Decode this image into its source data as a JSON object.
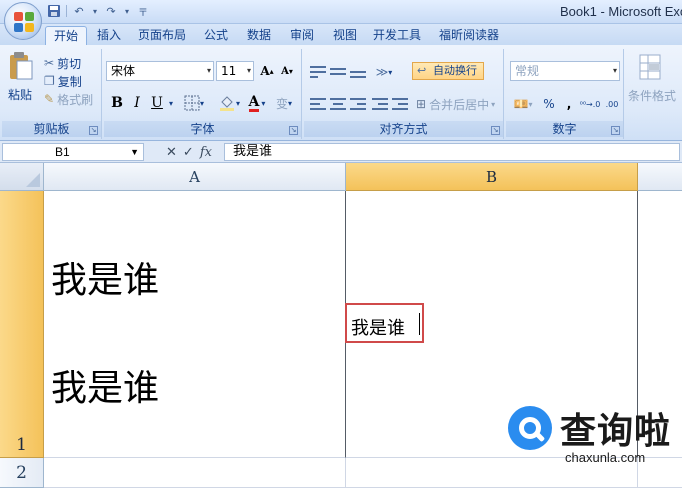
{
  "app": {
    "window_title": "Book1 - Microsoft Exc"
  },
  "tabs": [
    {
      "label": "开始",
      "active": true
    },
    {
      "label": "插入"
    },
    {
      "label": "页面布局"
    },
    {
      "label": "公式"
    },
    {
      "label": "数据"
    },
    {
      "label": "审阅"
    },
    {
      "label": "视图"
    },
    {
      "label": "开发工具"
    },
    {
      "label": "福昕阅读器"
    }
  ],
  "ribbon": {
    "clipboard": {
      "paste_label": "粘贴",
      "cut_label": "剪切",
      "copy_label": "复制",
      "format_painter_label": "格式刷",
      "group_label": "剪贴板"
    },
    "font": {
      "font_name": "宋体",
      "font_size": "11",
      "bold": "B",
      "italic": "I",
      "underline": "U",
      "grow_glyph": "A",
      "shrink_glyph": "A",
      "font_color_glyph": "A",
      "phonetic_glyph": "变",
      "group_label": "字体"
    },
    "alignment": {
      "wrap_text_label": "自动换行",
      "merge_center_label": "合并后居中",
      "group_label": "对齐方式"
    },
    "number": {
      "format_value": "常规",
      "percent_glyph": "%",
      "comma_glyph": ",",
      "inc_decimal": "⁰⁰→.0",
      "dec_decimal": ".00",
      "group_label": "数字"
    },
    "styles": {
      "conditional_label": "条件格式"
    }
  },
  "formula_bar": {
    "name_box": "B1",
    "cancel_glyph": "✕",
    "enter_glyph": "✓",
    "fx_glyph": "fx",
    "content": "我是谁"
  },
  "grid": {
    "columns": [
      "A",
      "B"
    ],
    "rows": [
      "1",
      "2"
    ],
    "cells": {
      "A1_line1": "我是谁",
      "A1_line2": "我是谁",
      "B1_edit": "我是谁"
    }
  },
  "watermark": {
    "brand_cn": "查询啦",
    "brand_url": "chaxunla.com"
  },
  "colors": {
    "accent": "#f4c25a",
    "edit_border": "#d04a4a",
    "watermark_blue": "#2a8cef"
  }
}
